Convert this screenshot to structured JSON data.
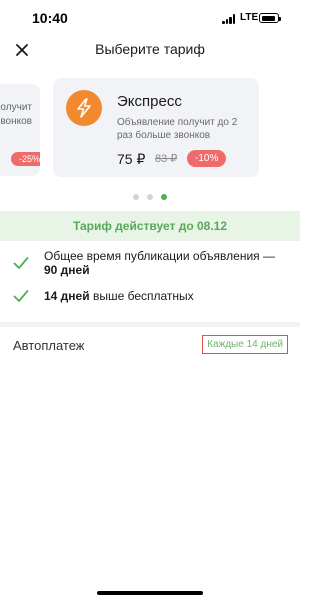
{
  "status": {
    "time": "10:40",
    "network": "LTE"
  },
  "header": {
    "title": "Выберите тариф",
    "close_icon": "close-icon"
  },
  "prev_card": {
    "line1": "я получит",
    "line2": "е звонков",
    "badge": "-25%"
  },
  "card": {
    "icon": "lightning-icon",
    "title": "Экспресс",
    "description": "Объявление получит до 2 раз больше звонков",
    "price": "75 ₽",
    "old_price": "83 ₽",
    "discount": "-10%"
  },
  "pagination": {
    "count": 3,
    "active_index": 2
  },
  "validity": {
    "text": "Тариф действует до 08.12"
  },
  "features": [
    {
      "icon": "check-icon",
      "text": "Общее время публикации объявления —",
      "bold": "90 дней"
    },
    {
      "icon": "check-icon",
      "bold": "14 дней",
      "text": " выше бесплатных"
    }
  ],
  "autopay": {
    "label": "Автоплатеж",
    "value": "Каждые 14 дней"
  },
  "colors": {
    "accent_green": "#58a85a",
    "discount_red": "#ef6b6b",
    "icon_orange": "#f2892e",
    "card_bg": "#f1f3f6"
  }
}
